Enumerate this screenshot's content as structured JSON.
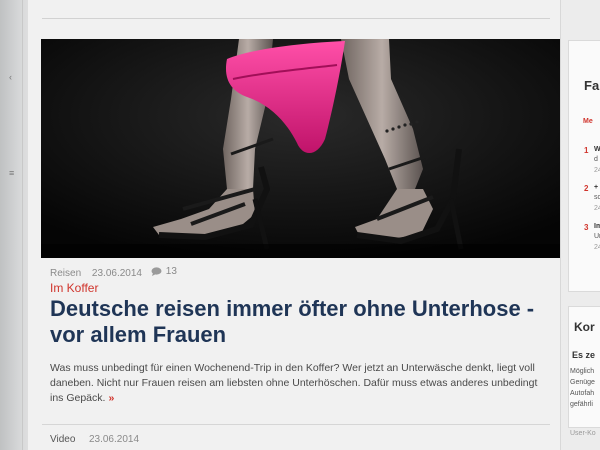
{
  "left_rail": {
    "mark1": "‹",
    "mark2": "≡"
  },
  "article": {
    "category": "Reisen",
    "date": "23.06.2014",
    "comments": "13",
    "kicker": "Im Koffer",
    "headline": "Deutsche reisen immer öfter ohne Unterhose - vor allem Frauen",
    "teaser": "Was muss unbedingt für einen Wochenend-Trip in den Koffer? Wer jetzt an Unterwäsche denkt, liegt voll daneben. Nicht nur Frauen reisen am liebsten ohne Unterhöschen. Dafür muss etwas anderes unbedingt ins Gepäck.",
    "more": "»"
  },
  "next_article": {
    "category": "Video",
    "date": "23.06.2014"
  },
  "sidebar": {
    "box1_title": "Fa",
    "tab_label": "Me",
    "items": [
      {
        "num": "1",
        "line1": "W",
        "line2": "d",
        "line3": "24"
      },
      {
        "num": "2",
        "line1": "+",
        "line2": "sc",
        "line3": "24"
      },
      {
        "num": "3",
        "line1": "Im",
        "line2": "Ur",
        "line3": "24"
      }
    ],
    "box2_title": "Kor",
    "box2_subtitle": "Es ze",
    "box2_lines": [
      "Möglich",
      "Genüge",
      "Autofah",
      "gefährli"
    ],
    "footer": "User-Ko"
  },
  "colors": {
    "headline": "#1f3556",
    "kicker": "#d0342c",
    "pink": "#e0237e"
  }
}
